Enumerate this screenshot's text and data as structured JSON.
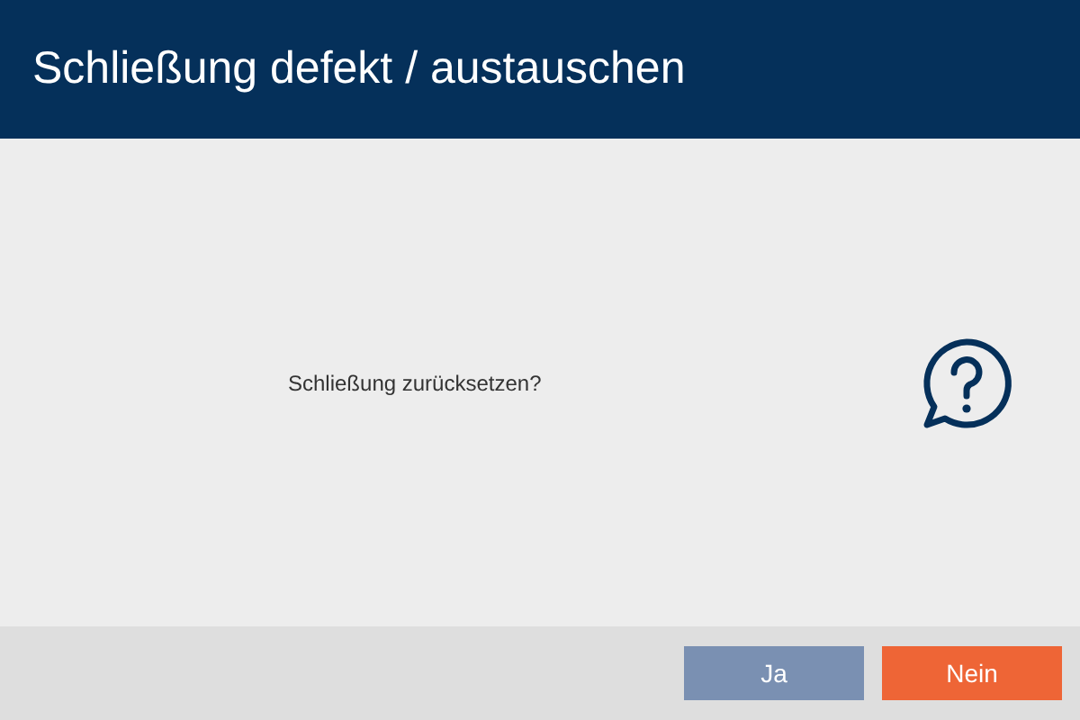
{
  "window": {
    "title": "Schließung defekt / austauschen"
  },
  "message": "Schließung zurücksetzen?",
  "buttons": [
    {
      "label": "Ja",
      "kind": "secondary"
    },
    {
      "label": "Nein",
      "kind": "primary"
    }
  ]
}
